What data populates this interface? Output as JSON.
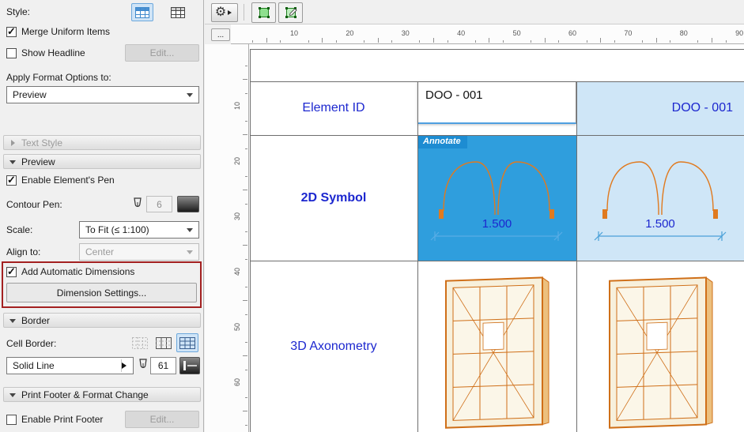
{
  "colors": {
    "selected_cell_blue": "#2f9edd",
    "highlight_cell_blue": "#cfe6f7",
    "table_text_blue": "#1c27cf",
    "door_orange": "#cf6f18",
    "attention_red": "#a32020",
    "annotate_blue": "#1d8cd2"
  },
  "panel": {
    "style_label": "Style:",
    "merge_uniform_label": "Merge Uniform Items",
    "show_headline_label": "Show Headline",
    "edit_label": "Edit...",
    "apply_format_label": "Apply Format Options to:",
    "apply_format_value": "Preview",
    "text_style_section": "Text Style",
    "preview_section": "Preview",
    "enable_pen_label": "Enable Element's Pen",
    "contour_pen_label": "Contour Pen:",
    "contour_pen_value": "6",
    "scale_label": "Scale:",
    "scale_value": "To Fit (≤ 1:100)",
    "align_label": "Align to:",
    "align_value": "Center",
    "auto_dim_label": "Add Automatic Dimensions",
    "dim_settings_label": "Dimension Settings...",
    "border_section": "Border",
    "cell_border_label": "Cell Border:",
    "line_type_value": "Solid Line",
    "border_pen_value": "61",
    "print_section": "Print Footer & Format Change",
    "print_footer_label": "Enable Print Footer",
    "edit2_label": "Edit..."
  },
  "ruler": {
    "corner_label": "...",
    "h_labels": [
      "10",
      "20",
      "30",
      "40",
      "50",
      "60",
      "70",
      "80",
      "90"
    ],
    "v_labels": [
      "10",
      "20",
      "30",
      "40",
      "50",
      "60"
    ]
  },
  "preview": {
    "row_labels": [
      "Element ID",
      "2D Symbol",
      "3D Axonometry"
    ],
    "element_id_value": "DOO - 001",
    "element_id_value_alt": "DOO - 001",
    "annotate_label": "Annotate",
    "dimension_value": "1.500"
  }
}
